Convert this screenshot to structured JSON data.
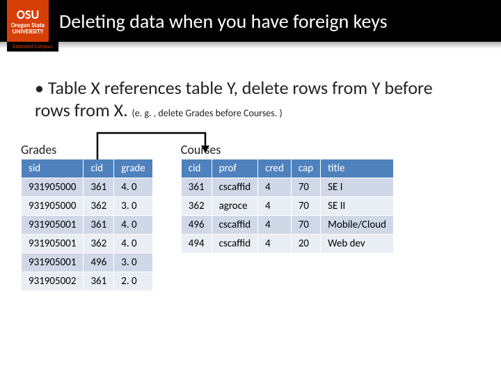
{
  "logo": {
    "osu": "OSU",
    "line1": "Oregon State",
    "line2": "UNIVERSITY",
    "ext": "Extended Campus"
  },
  "title": "Deleting data when you have foreign keys",
  "bullet": "Table X references table Y, delete rows from Y before rows from X.",
  "bullet_note": "(e. g. , delete Grades before Courses. )",
  "grades": {
    "label": "Grades",
    "headers": [
      "sid",
      "cid",
      "grade"
    ],
    "rows": [
      [
        "931905000",
        "361",
        "4. 0"
      ],
      [
        "931905000",
        "362",
        "3. 0"
      ],
      [
        "931905001",
        "361",
        "4. 0"
      ],
      [
        "931905001",
        "362",
        "4. 0"
      ],
      [
        "931905001",
        "496",
        "3. 0"
      ],
      [
        "931905002",
        "361",
        "2. 0"
      ]
    ]
  },
  "courses": {
    "label": "Courses",
    "headers": [
      "cid",
      "prof",
      "cred",
      "cap",
      "title"
    ],
    "rows": [
      [
        "361",
        "cscaffid",
        "4",
        "70",
        "SE I"
      ],
      [
        "362",
        "agroce",
        "4",
        "70",
        "SE II"
      ],
      [
        "496",
        "cscaffid",
        "4",
        "70",
        "Mobile/Cloud"
      ],
      [
        "494",
        "cscaffid",
        "4",
        "20",
        "Web dev"
      ]
    ]
  }
}
